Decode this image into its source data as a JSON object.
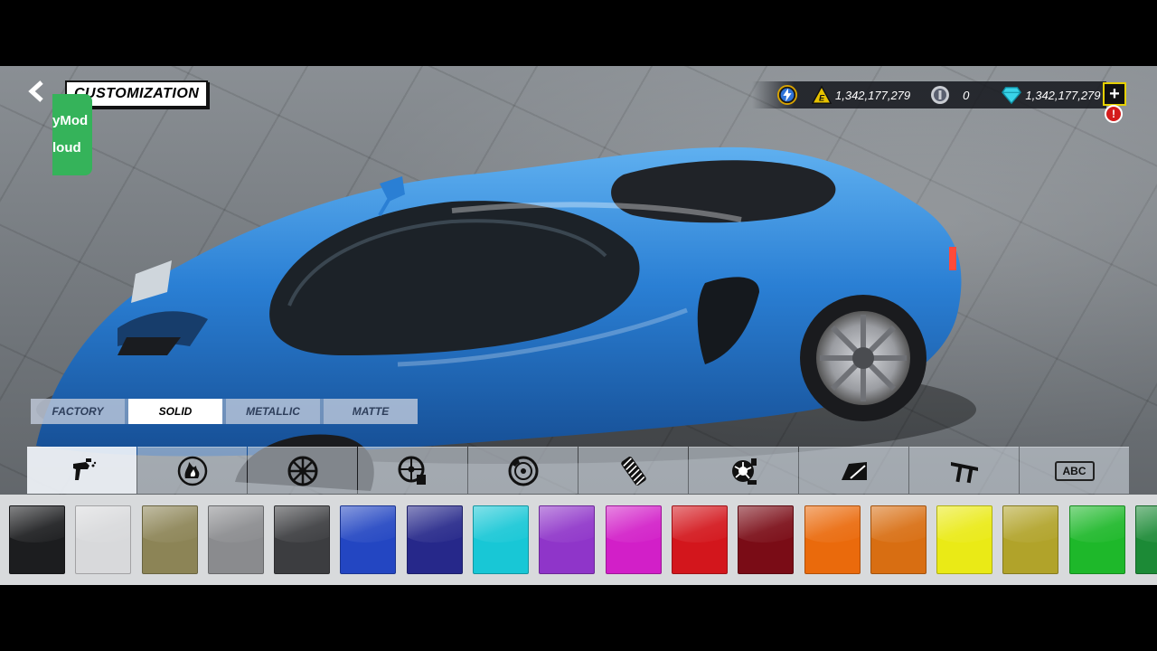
{
  "header": {
    "back_icon": "back-arrow-icon",
    "title": "CUSTOMIZATION",
    "watermark_lines": [
      "yMod",
      "loud"
    ]
  },
  "currency": {
    "energy_icon": "energy-icon",
    "cash_icon": "cash-e-icon",
    "cash_value": "1,342,177,279",
    "parts_icon": "wrench-icon",
    "parts_value": "0",
    "diamond_icon": "diamond-icon",
    "diamond_value": "1,342,177,279",
    "add_label": "+",
    "alert_label": "!"
  },
  "paint_tabs": [
    {
      "label": "FACTORY",
      "active": false
    },
    {
      "label": "SOLID",
      "active": true
    },
    {
      "label": "METALLIC",
      "active": false
    },
    {
      "label": "MATTE",
      "active": false
    }
  ],
  "categories": [
    {
      "icon": "spray-gun-icon",
      "active": true
    },
    {
      "icon": "flame-decal-icon",
      "active": false
    },
    {
      "icon": "rim-icon",
      "active": false
    },
    {
      "icon": "rim-paint-icon",
      "active": false
    },
    {
      "icon": "brake-disc-icon",
      "active": false
    },
    {
      "icon": "tire-icon",
      "active": false
    },
    {
      "icon": "turbo-icon",
      "active": false
    },
    {
      "icon": "window-tint-icon",
      "active": false
    },
    {
      "icon": "spoiler-icon",
      "active": false
    },
    {
      "icon": "license-plate-icon",
      "label": "ABC",
      "active": false
    }
  ],
  "swatches": [
    {
      "color": "#1c1d1f",
      "name": "black"
    },
    {
      "color": "#d8d9db",
      "name": "white"
    },
    {
      "color": "#8c8456",
      "name": "olive"
    },
    {
      "color": "#8a8b8e",
      "name": "silver"
    },
    {
      "color": "#3c3d40",
      "name": "dark-gray"
    },
    {
      "color": "#2346c2",
      "name": "blue"
    },
    {
      "color": "#26288a",
      "name": "navy"
    },
    {
      "color": "#18c7d6",
      "name": "cyan"
    },
    {
      "color": "#8f35c9",
      "name": "purple"
    },
    {
      "color": "#d21fc8",
      "name": "magenta"
    },
    {
      "color": "#d3161c",
      "name": "red"
    },
    {
      "color": "#7a0c16",
      "name": "dark-red"
    },
    {
      "color": "#ea6a0c",
      "name": "orange"
    },
    {
      "color": "#d86e12",
      "name": "dark-orange"
    },
    {
      "color": "#eaea16",
      "name": "yellow"
    },
    {
      "color": "#b1a32a",
      "name": "dark-yellow"
    },
    {
      "color": "#1eb82a",
      "name": "green"
    },
    {
      "color": "#1c8a36",
      "name": "dark-green"
    }
  ],
  "colors": {
    "car_body": "#2a7fd4",
    "accent_yellow": "#e6d000",
    "watermark_green": "#35b35a"
  }
}
